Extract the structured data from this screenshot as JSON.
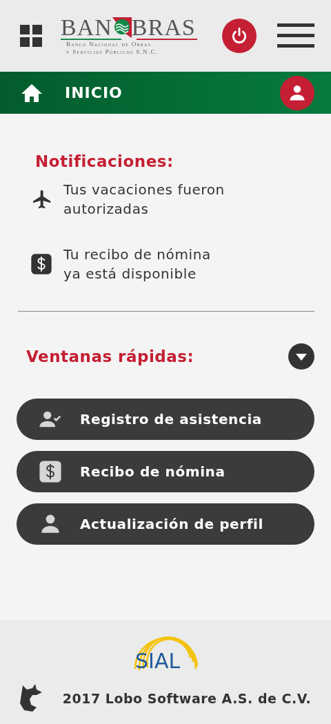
{
  "header": {
    "logo": {
      "left": "BAN",
      "right": "BRAS",
      "subtitle": [
        "Banco Nacional de Obras",
        "y Servicios Públicos S.N.C."
      ]
    }
  },
  "nav": {
    "title": "INICIO"
  },
  "notifications": {
    "title": "Notificaciones:",
    "items": [
      {
        "kind": "plane",
        "lines": [
          "Tus vacaciones fueron",
          "autorizadas"
        ]
      },
      {
        "kind": "dollar",
        "lines": [
          "Tu recibo de nómina",
          "ya está disponible"
        ]
      }
    ]
  },
  "quick": {
    "title": "Ventanas rápidas:",
    "buttons": [
      {
        "kind": "user-check",
        "label": "Registro de asistencia"
      },
      {
        "kind": "dollar",
        "label": "Recibo de nómina"
      },
      {
        "kind": "user",
        "label": "Actualización de perfil"
      }
    ]
  },
  "footer": {
    "brand": "SIAL",
    "copyright": "2017 Lobo Software A.S. de C.V."
  }
}
